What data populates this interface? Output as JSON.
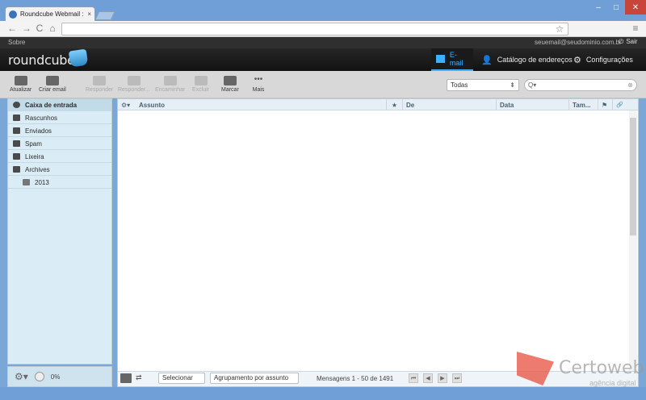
{
  "browser": {
    "tab_title": "Roundcube Webmail :: Ca",
    "tab_close": "×",
    "window_controls": {
      "min": "–",
      "max": "□",
      "close": "✕"
    },
    "back": "←",
    "forward": "→",
    "reload": "C",
    "home": "⌂",
    "star": "☆",
    "menu": "≡"
  },
  "topbar": {
    "about": "Sobre",
    "user_email": "seuemail@seudominio.com.br",
    "logout": "Sair"
  },
  "header": {
    "logo": "roundcube",
    "nav": {
      "email": "E-mail",
      "addressbook": "Catálogo de endereços",
      "settings": "Configurações"
    }
  },
  "actions": {
    "refresh": "Atualizar",
    "compose": "Criar email",
    "reply": "Responder",
    "reply_all": "Responder...",
    "forward": "Encaminhar",
    "delete": "Excluir",
    "mark": "Marcar",
    "more": "Mais"
  },
  "filter": {
    "selected": "Todas"
  },
  "search": {
    "placeholder": "Q▾"
  },
  "folders": [
    {
      "label": "Caixa de entrada"
    },
    {
      "label": "Rascunhos"
    },
    {
      "label": "Enviados"
    },
    {
      "label": "Spam"
    },
    {
      "label": "Lixeira"
    },
    {
      "label": "Archives"
    },
    {
      "label": "2013"
    }
  ],
  "quota": {
    "label": "0%"
  },
  "list_columns": {
    "settings": "⚙▾",
    "subject": "Assunto",
    "from": "De",
    "date": "Data",
    "size": "Tam...",
    "flag": "⚑",
    "attachment": "🔗"
  },
  "footer": {
    "select": "Selecionar",
    "threads": "Agrupamento por assunto",
    "count": "Mensagens 1 - 50 de 1491"
  },
  "watermark": {
    "brand": "Certoweb",
    "tagline": "agência digital"
  },
  "colors": {
    "accent": "#3fb0ff",
    "panel": "#daecf5"
  }
}
